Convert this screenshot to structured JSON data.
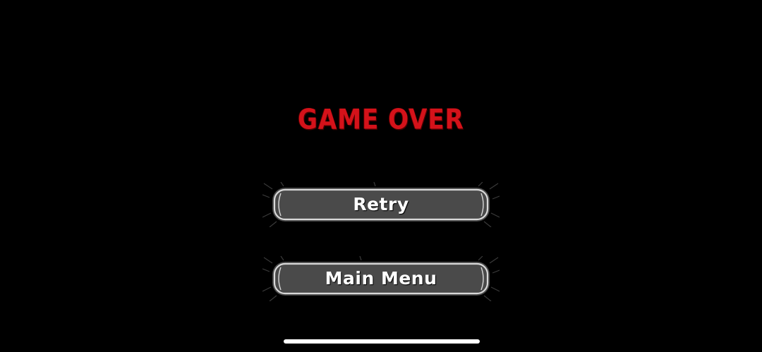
{
  "game_over": {
    "title": "GAME OVER",
    "title_color": "#d4121a"
  },
  "buttons": {
    "retry_label": "Retry",
    "main_menu_label": "Main Menu",
    "face_color": "#4a4a4a",
    "rim_color": "#d8d8d8"
  },
  "system": {
    "home_indicator_color": "#ffffff"
  }
}
